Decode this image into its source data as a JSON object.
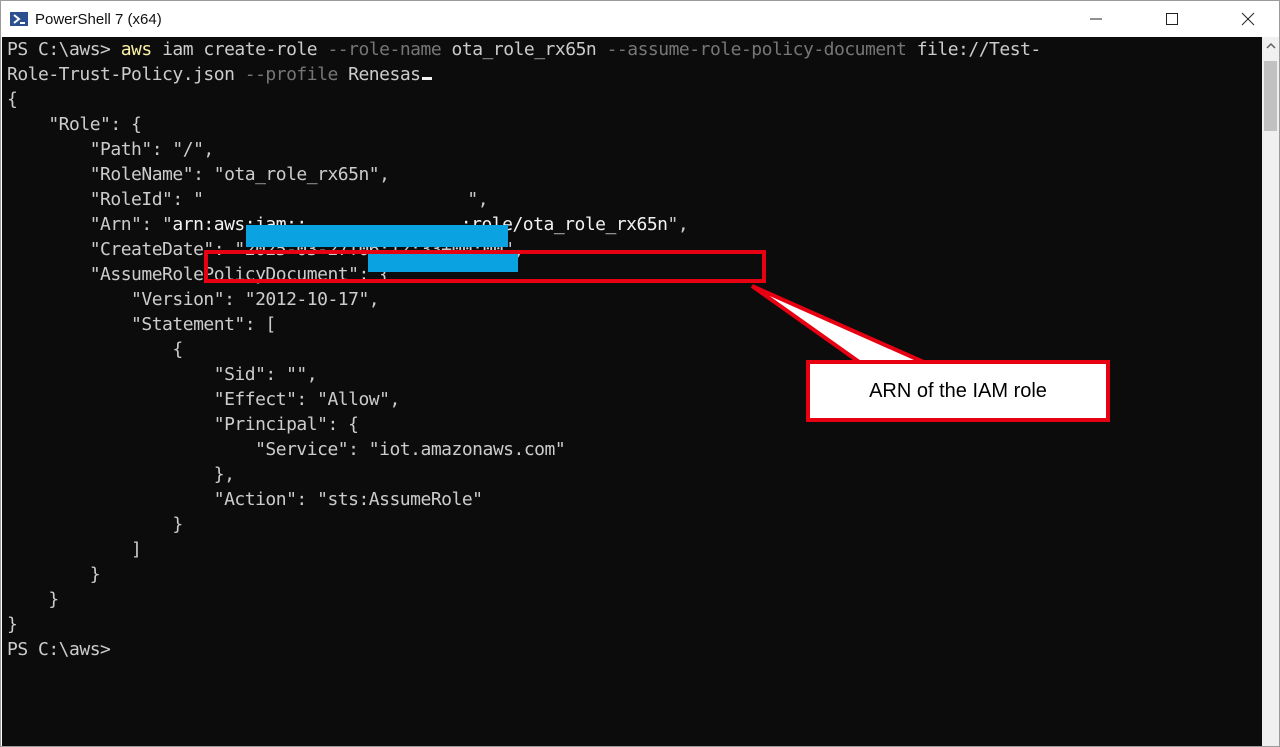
{
  "window": {
    "title": "PowerShell 7 (x64)",
    "icon": "powershell-icon",
    "controls": [
      "minimize-icon",
      "maximize-icon",
      "close-icon"
    ]
  },
  "terminal": {
    "prompt1": "PS C:\\aws> ",
    "cmd_aws": "aws",
    "cmd_part1": " iam create-role ",
    "flag_role_name": "--role-name",
    "arg_role_name": " ota_role_rx65n ",
    "flag_assume": "--assume-role-policy-document",
    "arg_file": " file://Test-",
    "arg_file_cont": "Role-Trust-Policy.json ",
    "flag_profile": "--profile",
    "arg_profile": " Renesas",
    "json_lines": [
      "{",
      "    \"Role\": {",
      "        \"Path\": \"/\",",
      "        \"RoleName\": \"ota_role_rx65n\",",
      "        \"RoleId\": \"",
      "        \"Arn\": \"",
      "        \"CreateDate\": \"2025-03-27T06:12:33+00:00\",",
      "        \"AssumeRolePolicyDocument\": {",
      "            \"Version\": \"2012-10-17\",",
      "            \"Statement\": [",
      "                {",
      "                    \"Sid\": \"\",",
      "                    \"Effect\": \"Allow\",",
      "                    \"Principal\": {",
      "                        \"Service\": \"iot.amazonaws.com\"",
      "                    },",
      "                    \"Action\": \"sts:AssumeRole\"",
      "                }",
      "            ]",
      "        }",
      "    }",
      "}"
    ],
    "roleid_tail": "\",",
    "arn_prefix": "arn:aws:iam::",
    "arn_suffix": ":role/ota_role_rx65n",
    "arn_tail": "\",",
    "prompt2": "PS C:\\aws>"
  },
  "annotation": {
    "label": "ARN of the IAM role",
    "color": "#e60012"
  },
  "colors": {
    "terminal_bg": "#0c0c0c",
    "text": "#cccccc",
    "command": "#f9f1a5",
    "flag": "#767676",
    "redaction": "#0aa2e0"
  }
}
